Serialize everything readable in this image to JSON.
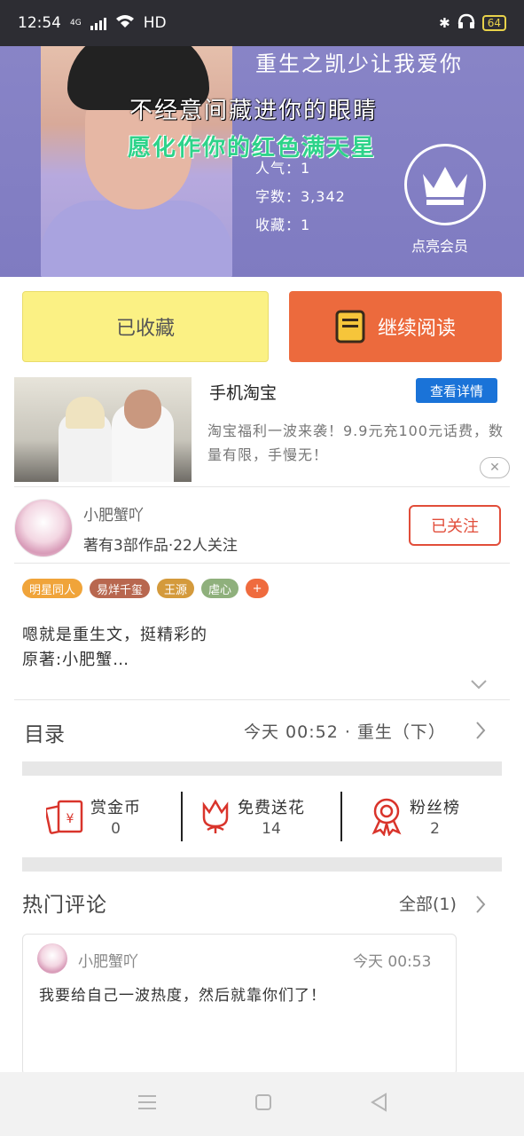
{
  "status_bar": {
    "time": "12:54",
    "network": "4G",
    "hd": "HD",
    "battery": "64"
  },
  "book": {
    "title": "重生之凯少让我爱你",
    "overlay_line1": "不经意间藏进你的眼睛",
    "overlay_line2": "愿化作你的红色满天星",
    "popularity": "人气：1",
    "word_count": "字数：3,342",
    "favorites": "收藏：1",
    "vip_label": "点亮会员"
  },
  "actions": {
    "favorited_label": "已收藏",
    "continue_label": "继续阅读"
  },
  "ad": {
    "title": "手机淘宝",
    "button": "查看详情",
    "description": "淘宝福利一波来袭！9.9元充100元话费，数量有限，手慢无！",
    "close": "✕"
  },
  "author": {
    "name": "小肥蟹吖",
    "meta": "著有3部作品·22人关注",
    "follow_label": "已关注"
  },
  "tags": [
    {
      "label": "明星同人",
      "color": "#f0a43a"
    },
    {
      "label": "易烊千玺",
      "color": "#b8674f"
    },
    {
      "label": "王源",
      "color": "#d49a3c"
    },
    {
      "label": "虐心",
      "color": "#8fb07c"
    },
    {
      "label": "+",
      "color": "#ef6b3e"
    }
  ],
  "description": {
    "line1": "嗯就是重生文，挺精彩的",
    "line2": "原著:小肥蟹…"
  },
  "toc": {
    "label": "目录",
    "latest": "今天 00:52 · 重生（下）"
  },
  "stats": [
    {
      "label": "赏金币",
      "value": "0",
      "icon": "red-envelope-icon"
    },
    {
      "label": "免费送花",
      "value": "14",
      "icon": "flower-icon"
    },
    {
      "label": "粉丝榜",
      "value": "2",
      "icon": "badge-icon"
    }
  ],
  "comments": {
    "label": "热门评论",
    "all_label": "全部(1)",
    "items": [
      {
        "user": "小肥蟹吖",
        "time": "今天 00:53",
        "text": "我要给自己一波热度，然后就靠你们了！"
      }
    ]
  },
  "colors": {
    "header_bg": "#8a86c8",
    "fav_bg": "#fbf184",
    "read_bg": "#ec6a3d",
    "accent_red": "#e14d3a",
    "ad_button": "#1a73d8"
  }
}
